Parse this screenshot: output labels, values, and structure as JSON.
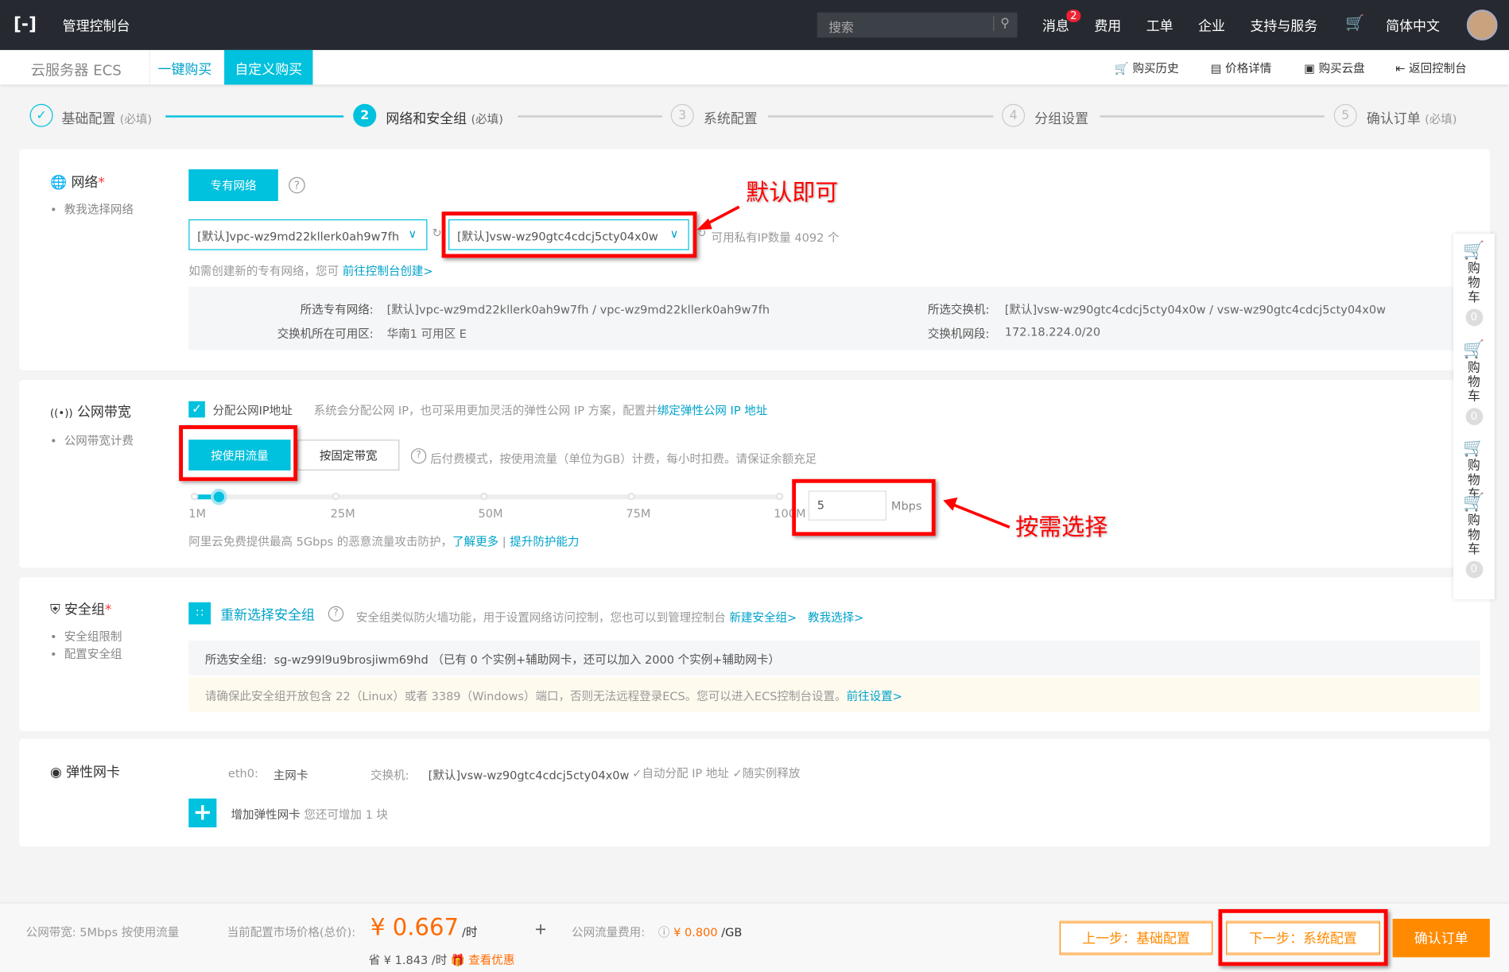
{
  "topbar": {
    "title": "管理控制台",
    "search_placeholder": "搜索",
    "nav": [
      "消息",
      "费用",
      "工单",
      "企业",
      "支持与服务",
      "简体中文"
    ],
    "message_badge": "2"
  },
  "subheader": {
    "product": "云服务器 ECS",
    "tabs": [
      "一键购买",
      "自定义购买"
    ],
    "active_tab": 1,
    "actions": [
      "购买历史",
      "价格详情",
      "购买云盘",
      "返回控制台"
    ]
  },
  "steps": [
    {
      "num": "✓",
      "label": "基础配置",
      "tag": "(必填)",
      "state": "done"
    },
    {
      "num": "2",
      "label": "网络和安全组",
      "tag": "(必填)",
      "state": "active"
    },
    {
      "num": "3",
      "label": "系统配置",
      "tag": "",
      "state": "todo"
    },
    {
      "num": "4",
      "label": "分组设置",
      "tag": "",
      "state": "todo"
    },
    {
      "num": "5",
      "label": "确认订单",
      "tag": "(必填)",
      "state": "todo"
    }
  ],
  "network": {
    "label": "网络",
    "required": "*",
    "help": "教我选择网络",
    "type_button": "专有网络",
    "vpc_select": "[默认]vpc-wz9md22kllerk0ah9w7fh",
    "vsw_select": "[默认]vsw-wz90gtc4cdcj5cty04x0w",
    "ip_count": "可用私有IP数量 4092 个",
    "hint": "如需创建新的专有网络，您可",
    "hint_link": "前往控制台创建>",
    "info": {
      "vpc_label": "所选专有网络:",
      "vpc_value": "[默认]vpc-wz9md22kllerk0ah9w7fh / vpc-wz9md22kllerk0ah9w7fh",
      "zone_label": "交换机所在可用区:",
      "zone_value": "华南1 可用区 E",
      "vsw_label": "所选交换机:",
      "vsw_value": "[默认]vsw-wz90gtc4cdcj5cty04x0w / vsw-wz90gtc4cdcj5cty04x0w",
      "cidr_label": "交换机网段:",
      "cidr_value": "172.18.224.0/20"
    },
    "annotation": "默认即可"
  },
  "bandwidth": {
    "label": "公网带宽",
    "help": "公网带宽计费",
    "assign_ip_checked": true,
    "assign_ip_label": "分配公网IP地址",
    "assign_desc": "系统会分配公网 IP，也可采用更加灵活的弹性公网 IP 方案，配置并",
    "assign_link": "绑定弹性公网 IP 地址",
    "billing_options": [
      "按使用流量",
      "按固定带宽"
    ],
    "billing_selected": 0,
    "billing_desc": "后付费模式，按使用流量（单位为GB）计费，每小时扣费。请保证余额充足",
    "slider_ticks": [
      "1M",
      "25M",
      "50M",
      "75M",
      "100M"
    ],
    "slider_value": 5,
    "slider_max": 100,
    "input_value": "5",
    "unit": "Mbps",
    "ddos_text": "阿里云免费提供最高 5Gbps 的恶意流量攻击防护，",
    "ddos_link1": "了解更多",
    "ddos_sep": "|",
    "ddos_link2": "提升防护能力",
    "annotation": "按需选择"
  },
  "security": {
    "label": "安全组",
    "required": "*",
    "help_items": [
      "安全组限制",
      "配置安全组"
    ],
    "reselect": "重新选择安全组",
    "desc": "安全组类似防火墙功能，用于设置网络访问控制，您也可以到管理控制台",
    "link1": "新建安全组>",
    "link2": "教我选择>",
    "selected_label": "所选安全组:",
    "selected_value": "sg-wz99l9u9brosjiwm69hd （已有 0 个实例+辅助网卡，还可以加入 2000 个实例+辅助网卡）",
    "warning": "请确保此安全组开放包含 22（Linux）或者 3389（Windows）端口，否则无法远程登录ECS。您可以进入ECS控制台设置。",
    "warning_link": "前往设置>"
  },
  "eni": {
    "label": "弹性网卡",
    "eth": "eth0:",
    "eth_type": "主网卡",
    "vsw_label": "交换机:",
    "vsw_value": "[默认]vsw-wz90gtc4cdcj5cty04x0w",
    "auto_ip": "✓自动分配 IP 地址",
    "release": "✓随实例释放",
    "add_label": "增加弹性网卡",
    "add_hint": "您还可增加 1 块"
  },
  "cart": {
    "label": "购物车",
    "count": "0"
  },
  "footer": {
    "bandwidth_summary": "公网带宽: 5Mbps 按使用流量",
    "price_label": "当前配置市场价格(总价):",
    "price": "¥ 0.667",
    "price_unit": "/时",
    "plus": "+",
    "traffic_label": "公网流量费用:",
    "traffic_price": "¥ 0.800",
    "traffic_unit": "/GB",
    "save_text": "省 ¥ 1.843 /时",
    "discount_link": "查看优惠",
    "prev": "上一步：基础配置",
    "next": "下一步：系统配置",
    "confirm": "确认订单"
  },
  "colors": {
    "accent": "#00c1de",
    "topbar": "#262a30",
    "orange": "#ff8a00",
    "annotation": "#ff0000"
  }
}
